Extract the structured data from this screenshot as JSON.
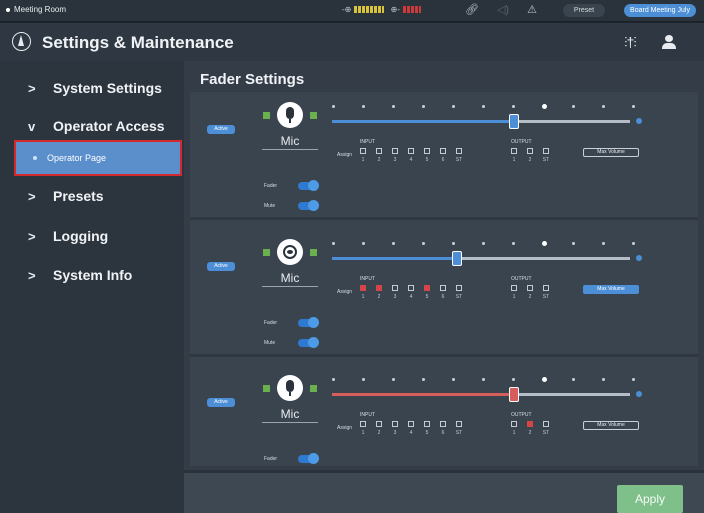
{
  "status_bar": {
    "room": "Meeting Room",
    "input_meter": "████ ██ █",
    "output_meter": "███",
    "preset_label": "Preset",
    "preset_value": "Board Meeting July"
  },
  "header": {
    "title": "Settings & Maintenance"
  },
  "sidebar": {
    "items": [
      {
        "label": "System Settings",
        "chevron": ">"
      },
      {
        "label": "Operator Access",
        "chevron": "v"
      },
      {
        "label": "Presets",
        "chevron": ">"
      },
      {
        "label": "Logging",
        "chevron": ">"
      },
      {
        "label": "System Info",
        "chevron": ">"
      }
    ],
    "sub_item": {
      "label": "Operator Page"
    }
  },
  "main": {
    "title": "Fader Settings",
    "apply_label": "Apply"
  },
  "common": {
    "active": "Active",
    "assign": "Assign",
    "input": "INPUT",
    "output": "OUTPUT",
    "max_volume": "Max Volume",
    "fader": "Fader",
    "mute": "Mute",
    "input_numbers": [
      "1",
      "2",
      "3",
      "4",
      "5",
      "6",
      "ST"
    ],
    "output_numbers": [
      "1",
      "2",
      "ST"
    ]
  },
  "channels": [
    {
      "name": "Mic",
      "icon": "microphone-icon",
      "level": 0.61,
      "track_color": "#4d8fd6",
      "inputs": [
        0,
        0,
        0,
        0,
        0,
        0,
        0
      ],
      "outputs": [
        0,
        0,
        0
      ],
      "max_volume_active": false
    },
    {
      "name": "Mic",
      "icon": "camera-icon",
      "level": 0.42,
      "track_color": "#4d8fd6",
      "inputs": [
        1,
        1,
        0,
        0,
        1,
        0,
        0
      ],
      "outputs": [
        0,
        0,
        0
      ],
      "max_volume_active": true
    },
    {
      "name": "Mic",
      "icon": "microphone-icon",
      "level": 0.61,
      "track_color": "#d75c5c",
      "inputs": [
        0,
        0,
        0,
        0,
        0,
        0,
        0
      ],
      "outputs": [
        0,
        1,
        0
      ],
      "max_volume_active": false
    }
  ]
}
